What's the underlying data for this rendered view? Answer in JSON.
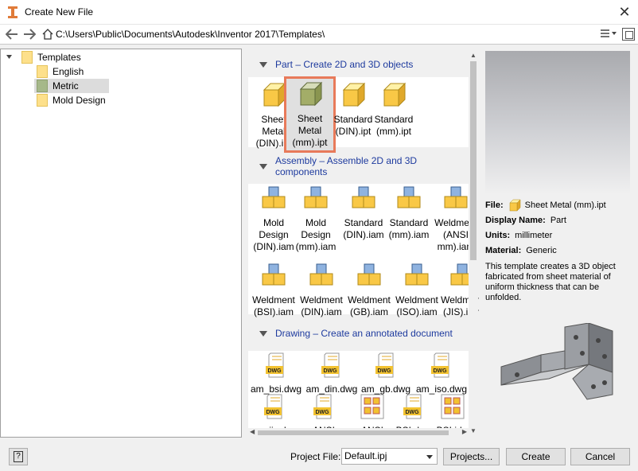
{
  "window": {
    "title": "Create New File",
    "close_glyph": "✕"
  },
  "address": {
    "path": "C:\\Users\\Public\\Documents\\Autodesk\\Inventor 2017\\Templates\\"
  },
  "tree": {
    "root": "Templates",
    "items": [
      "English",
      "Metric",
      "Mold Design"
    ],
    "selected": "Metric"
  },
  "sections": {
    "part": {
      "header": "Part – Create 2D and 3D objects",
      "items": [
        "Sheet\nMetal\n(DIN).ipt",
        "Sheet\nMetal\n(mm).ipt",
        "Standard\n(DIN).ipt",
        "Standard\n(mm).ipt"
      ]
    },
    "assembly": {
      "header": "Assembly – Assemble 2D and 3D components",
      "items": [
        "Mold\nDesign\n(DIN).iam",
        "Mold\nDesign\n(mm).iam",
        "Standard\n(DIN).iam",
        "Standard\n(mm).iam",
        "Weldment\n(ANSI\nmm).iam",
        "Weldment\n(BSI).iam",
        "Weldment\n(DIN).iam",
        "Weldment\n(GB).iam",
        "Weldment\n(ISO).iam",
        "Weldment\n(JIS).iam"
      ]
    },
    "drawing": {
      "header": "Drawing – Create an annotated document",
      "items": [
        "am_bsi.dwg",
        "am_din.dwg",
        "am_gb.dwg",
        "am_iso.dwg",
        "am_jis.dwg",
        "ANSI",
        "ANSI",
        "BSI.dwg",
        "BSI.idw"
      ]
    }
  },
  "details": {
    "file_label": "File:",
    "file_value": "Sheet Metal (mm).ipt",
    "display_name_label": "Display Name:",
    "display_name_value": "Part",
    "units_label": "Units:",
    "units_value": "millimeter",
    "material_label": "Material:",
    "material_value": "Generic",
    "description": "This template creates a 3D object fabricated from sheet material of uniform thickness that can be unfolded."
  },
  "bottom": {
    "help_glyph": "?",
    "project_file_label": "Project File:",
    "project_file_value": "Default.ipj",
    "projects_button": "Projects...",
    "create_button": "Create",
    "cancel_button": "Cancel"
  },
  "colors": {
    "section_header": "#1d3a9e",
    "selection_border": "#e87a5a",
    "folder": "#fde08b"
  },
  "icons": [
    "app-icon",
    "back-arrow-icon",
    "forward-arrow-icon",
    "home-icon",
    "view-menu-icon",
    "maximize-icon",
    "folder-icon",
    "part-cube-icon",
    "assembly-icon",
    "dwg-file-icon",
    "idw-file-icon",
    "help-icon"
  ]
}
